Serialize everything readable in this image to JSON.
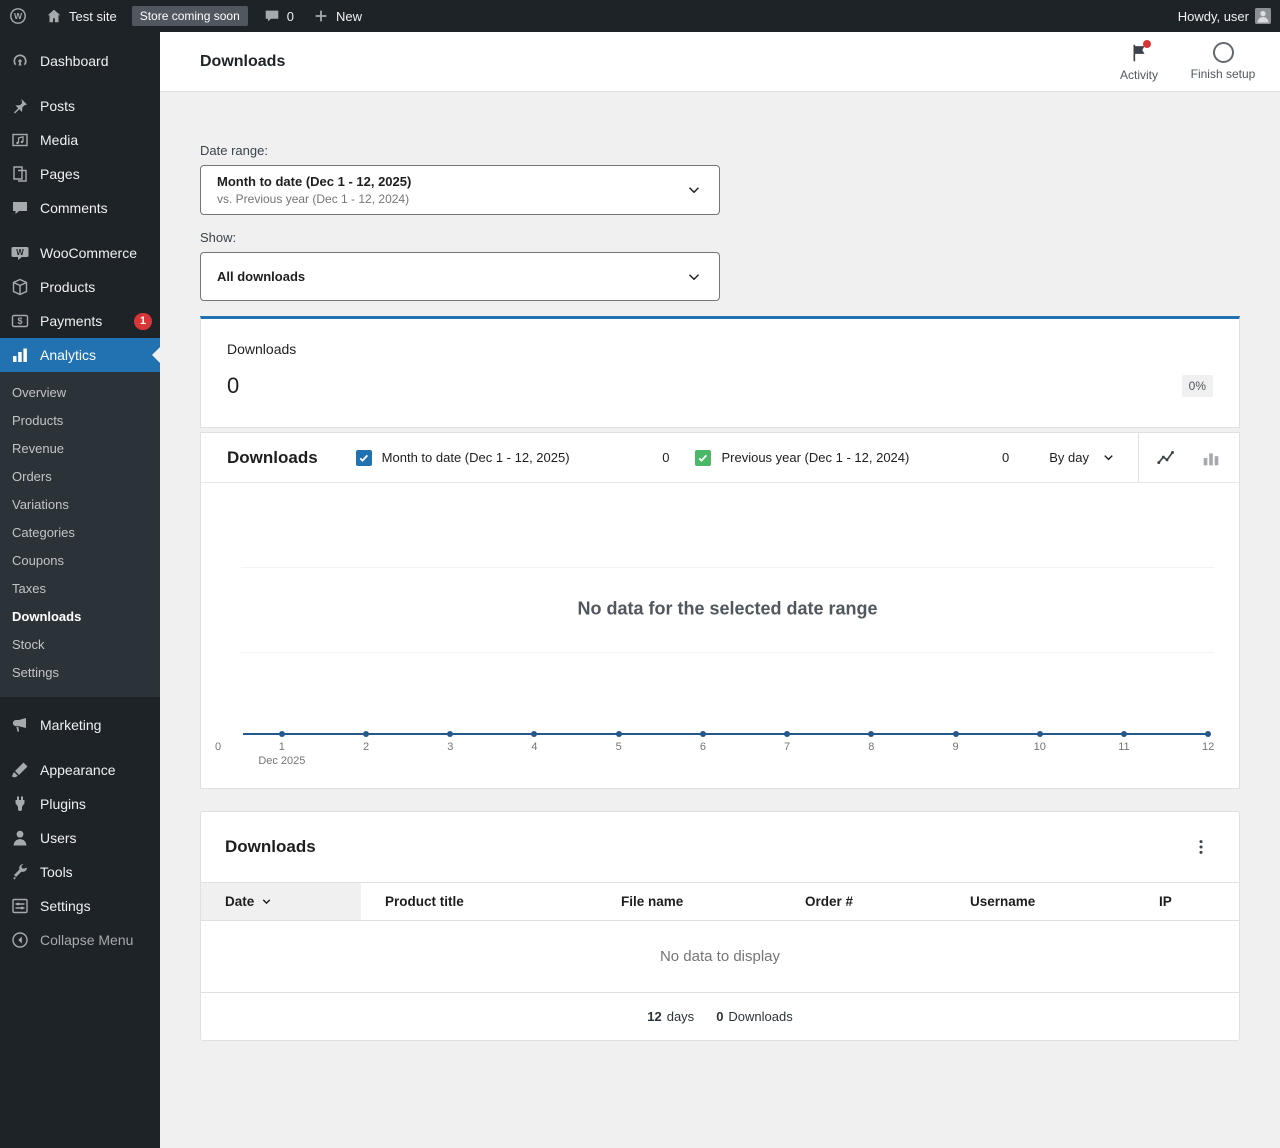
{
  "admin_bar": {
    "site_name": "Test site",
    "coming_soon_badge": "Store coming soon",
    "comments_count": "0",
    "new_label": "New",
    "howdy_text": "Howdy, user"
  },
  "sidebar": {
    "items": [
      {
        "label": "Dashboard"
      },
      {
        "label": "Posts"
      },
      {
        "label": "Media"
      },
      {
        "label": "Pages"
      },
      {
        "label": "Comments"
      },
      {
        "label": "WooCommerce"
      },
      {
        "label": "Products"
      },
      {
        "label": "Payments",
        "badge": "1"
      },
      {
        "label": "Analytics"
      },
      {
        "label": "Marketing"
      },
      {
        "label": "Appearance"
      },
      {
        "label": "Plugins"
      },
      {
        "label": "Users"
      },
      {
        "label": "Tools"
      },
      {
        "label": "Settings"
      },
      {
        "label": "Collapse Menu"
      }
    ],
    "analytics_submenu": [
      {
        "label": "Overview"
      },
      {
        "label": "Products"
      },
      {
        "label": "Revenue"
      },
      {
        "label": "Orders"
      },
      {
        "label": "Variations"
      },
      {
        "label": "Categories"
      },
      {
        "label": "Coupons"
      },
      {
        "label": "Taxes"
      },
      {
        "label": "Downloads"
      },
      {
        "label": "Stock"
      },
      {
        "label": "Settings"
      }
    ]
  },
  "header": {
    "title": "Downloads",
    "activity_label": "Activity",
    "finish_setup_label": "Finish setup"
  },
  "filters": {
    "date_range_label": "Date range:",
    "date_range_primary": "Month to date (Dec 1 - 12, 2025)",
    "date_range_secondary": "vs. Previous year (Dec 1 - 12, 2024)",
    "show_label": "Show:",
    "show_value": "All downloads"
  },
  "summary": {
    "label": "Downloads",
    "value": "0",
    "delta": "0%"
  },
  "chart": {
    "title": "Downloads",
    "legend": [
      {
        "label": "Month to date (Dec 1 - 12, 2025)",
        "value": "0",
        "color": "#2271b1",
        "checked": true
      },
      {
        "label": "Previous year (Dec 1 - 12, 2024)",
        "value": "0",
        "color": "#4ab866",
        "checked": true
      }
    ],
    "interval_label": "By day",
    "empty_message": "No data for the selected date range"
  },
  "chart_data": {
    "type": "line",
    "title": "Downloads",
    "x": [
      1,
      2,
      3,
      4,
      5,
      6,
      7,
      8,
      9,
      10,
      11,
      12
    ],
    "x_label_note": "Dec 2025",
    "series": [
      {
        "name": "Month to date (Dec 1 - 12, 2025)",
        "values": [
          0,
          0,
          0,
          0,
          0,
          0,
          0,
          0,
          0,
          0,
          0,
          0
        ]
      },
      {
        "name": "Previous year (Dec 1 - 12, 2024)",
        "values": [
          0,
          0,
          0,
          0,
          0,
          0,
          0,
          0,
          0,
          0,
          0,
          0
        ]
      }
    ],
    "y_ticks": [
      0
    ],
    "ylim": [
      0,
      1
    ],
    "interval": "day",
    "legend_position": "top",
    "grid": true
  },
  "table": {
    "title": "Downloads",
    "columns": [
      "Date",
      "Product title",
      "File name",
      "Order #",
      "Username",
      "IP"
    ],
    "sorted_column": "Date",
    "rows": [],
    "empty_message": "No data to display",
    "summary": {
      "days_value": "12",
      "days_label": "days",
      "downloads_value": "0",
      "downloads_label": "Downloads"
    }
  },
  "colors": {
    "accent": "#2271b1",
    "chart_line": "#24588c",
    "series_primary": "#2271b1",
    "series_secondary": "#4ab866",
    "notification": "#d63638"
  }
}
